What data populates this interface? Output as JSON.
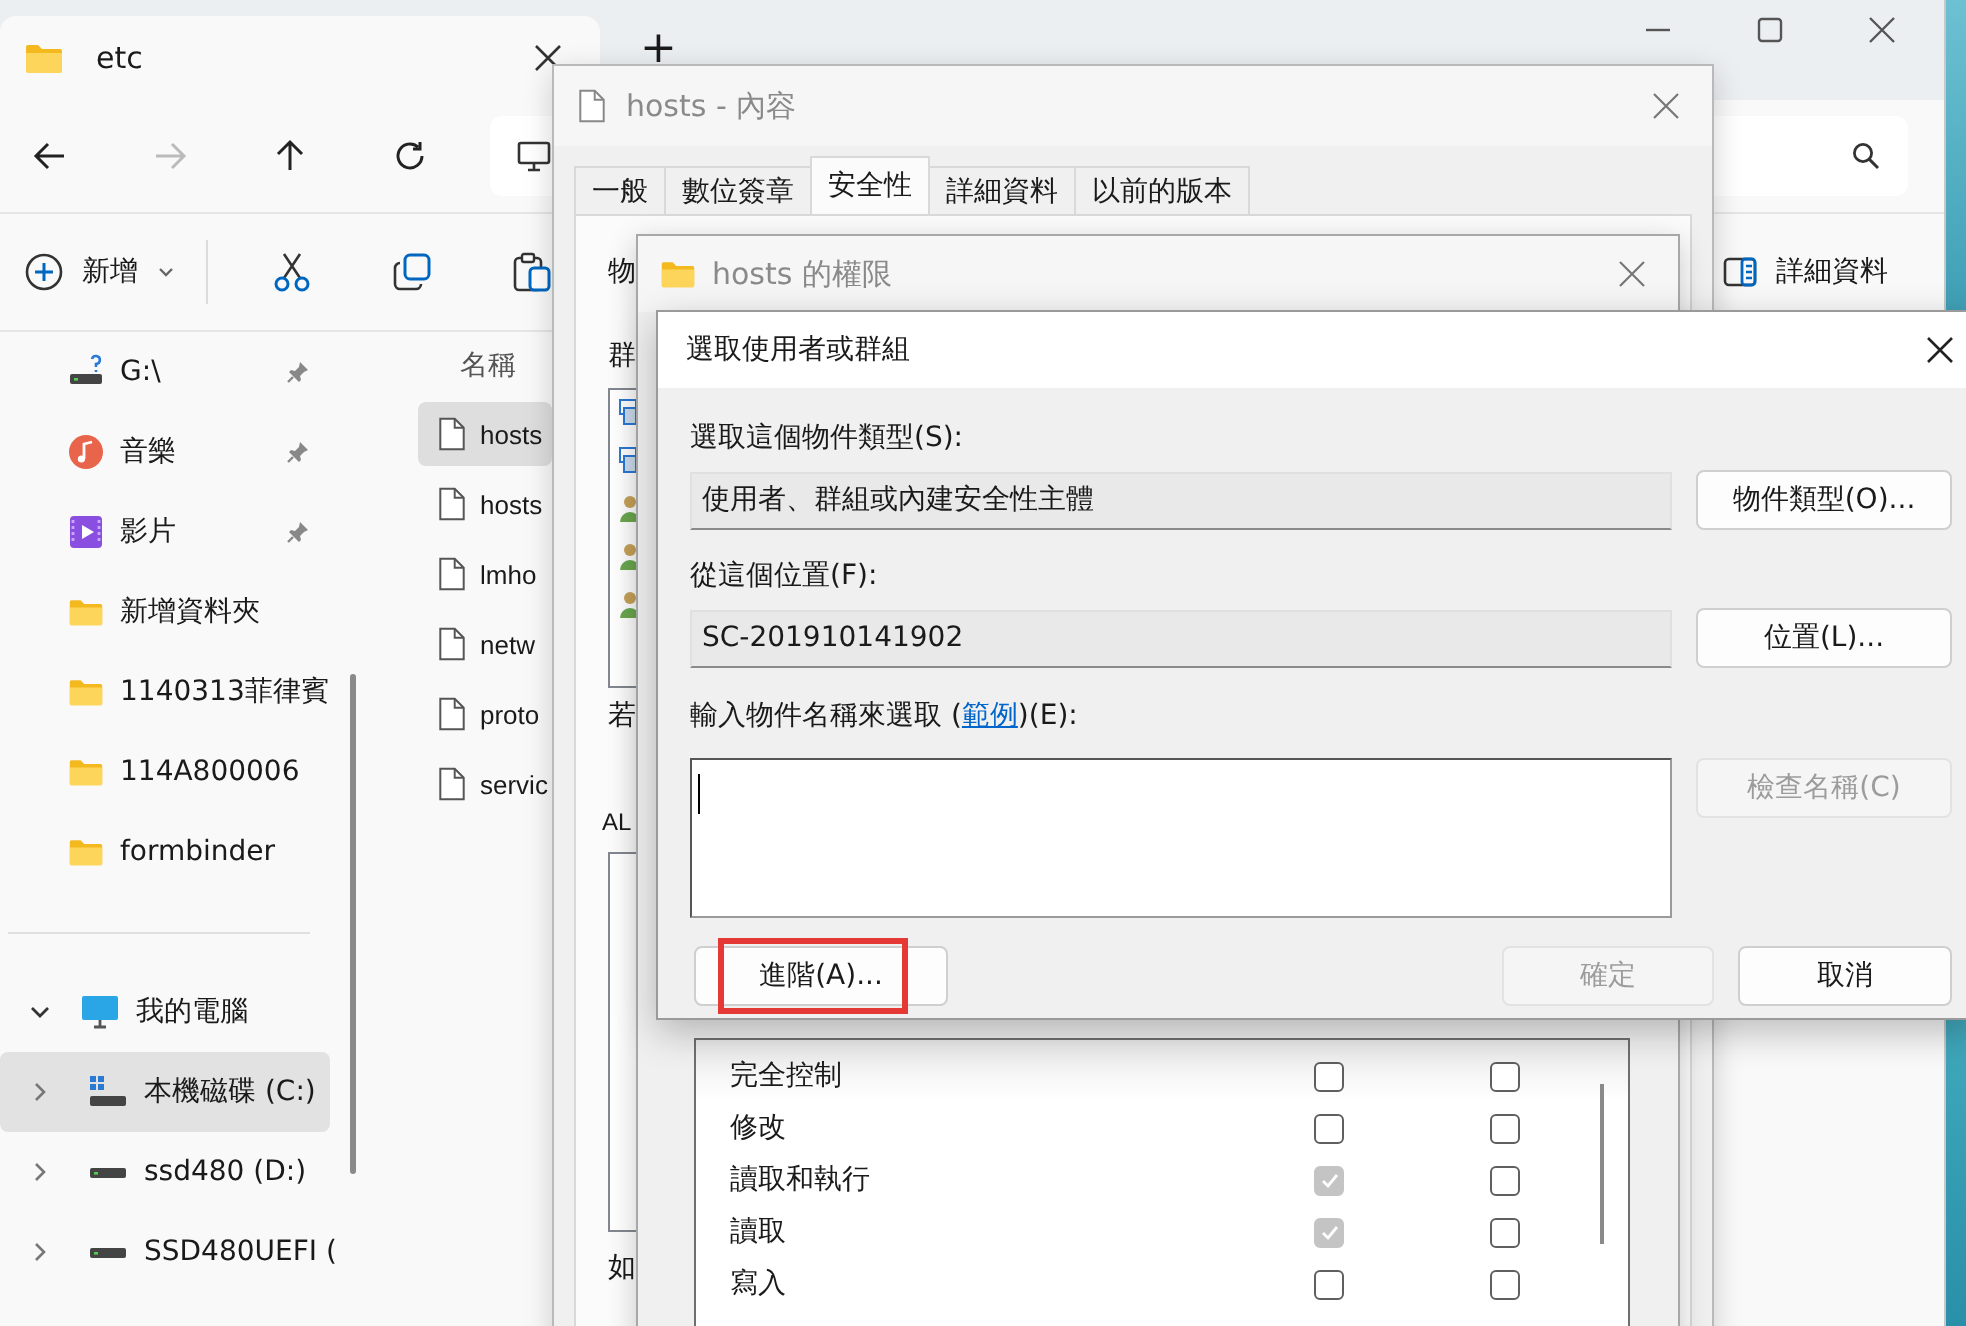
{
  "explorer": {
    "tab_title": "etc",
    "new_tab_symbol": "+",
    "command_bar": {
      "new_label": "新增",
      "details_label": "詳細資料"
    },
    "sidebar": {
      "pinned_items": [
        {
          "label": "G:\\",
          "kind": "network-drive",
          "pinned": true
        },
        {
          "label": "音樂",
          "kind": "music",
          "pinned": true
        },
        {
          "label": "影片",
          "kind": "video",
          "pinned": true
        },
        {
          "label": "新增資料夾",
          "kind": "folder",
          "pinned": false
        },
        {
          "label": "1140313菲律賓",
          "kind": "folder",
          "pinned": false
        },
        {
          "label": "114A800006",
          "kind": "folder",
          "pinned": false
        },
        {
          "label": "formbinder",
          "kind": "folder",
          "pinned": false
        }
      ],
      "this_pc": {
        "label": "我的電腦",
        "expanded": true,
        "children": [
          {
            "label": "本機磁碟 (C:)",
            "kind": "system-drive",
            "expanded": false,
            "selected": true
          },
          {
            "label": "ssd480 (D:)",
            "kind": "drive",
            "expanded": false,
            "selected": false
          },
          {
            "label": "SSD480UEFI (",
            "kind": "drive",
            "expanded": false,
            "selected": false
          }
        ]
      }
    },
    "files": {
      "column_1": "名稱",
      "rows": [
        {
          "name": "hosts",
          "selected": true
        },
        {
          "name": "hosts",
          "selected": false
        },
        {
          "name": "lmho",
          "selected": false
        },
        {
          "name": "netw",
          "selected": false
        },
        {
          "name": "proto",
          "selected": false
        },
        {
          "name": "servic",
          "selected": false
        }
      ]
    }
  },
  "properties": {
    "title": "hosts - 內容",
    "tabs": [
      {
        "label": "一般",
        "selected": false
      },
      {
        "label": "數位簽章",
        "selected": false
      },
      {
        "label": "安全性",
        "selected": true
      },
      {
        "label": "詳細資料",
        "selected": false
      },
      {
        "label": "以前的版本",
        "selected": false
      }
    ],
    "label_1": "物",
    "label_2": "群",
    "label_3": "若",
    "label_4": "AL",
    "label_5": "如"
  },
  "permissions": {
    "title": "hosts 的權限",
    "rows": [
      {
        "name": "完全控制",
        "allow_checked": false,
        "allow_disabled": false,
        "deny_checked": false
      },
      {
        "name": "修改",
        "allow_checked": false,
        "allow_disabled": false,
        "deny_checked": false
      },
      {
        "name": "讀取和執行",
        "allow_checked": true,
        "allow_disabled": true,
        "deny_checked": false
      },
      {
        "name": "讀取",
        "allow_checked": true,
        "allow_disabled": true,
        "deny_checked": false
      },
      {
        "name": "寫入",
        "allow_checked": false,
        "allow_disabled": false,
        "deny_checked": false
      }
    ]
  },
  "select_dialog": {
    "title": "選取使用者或群組",
    "object_type_label": "選取這個物件類型(S):",
    "object_type_value": "使用者、群組或內建安全性主體",
    "object_types_button": {
      "label": "物件類型(O)...",
      "disabled": false
    },
    "location_label": "從這個位置(F):",
    "location_value": "SC-201910141902",
    "locations_button": {
      "label": "位置(L)...",
      "disabled": false
    },
    "name_label": {
      "before": "輸入物件名稱來選取 (",
      "link": "範例",
      "after": ")(E):"
    },
    "check_names_button": {
      "label": "檢查名稱(C)",
      "disabled": true
    },
    "advanced_button": {
      "label": "進階(A)...",
      "disabled": false,
      "highlighted": true
    },
    "ok_button": {
      "label": "確定",
      "disabled": true
    },
    "cancel_button": {
      "label": "取消",
      "disabled": false
    }
  }
}
